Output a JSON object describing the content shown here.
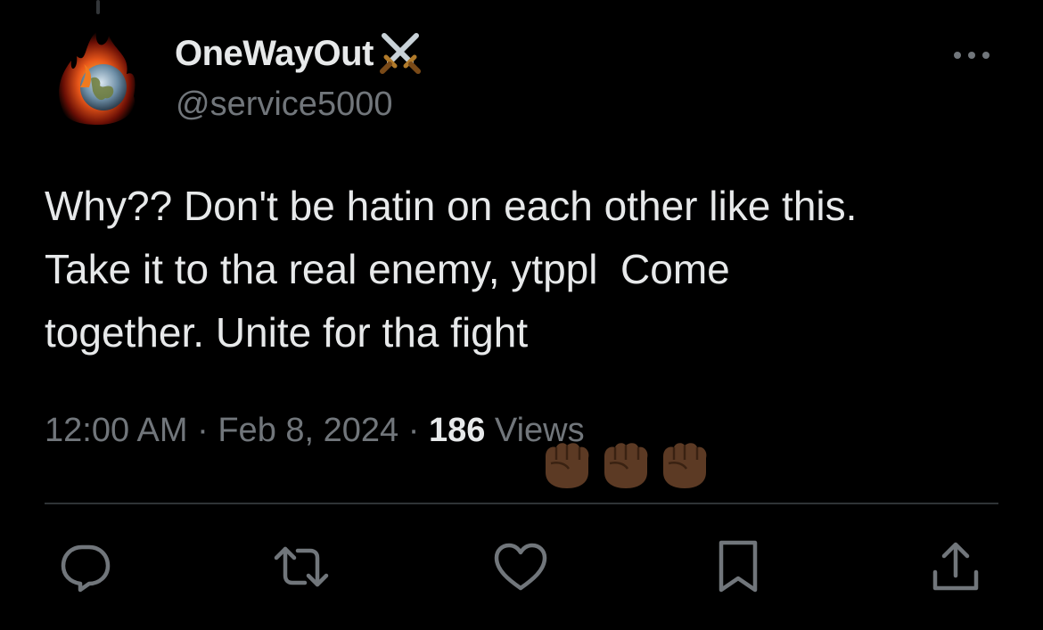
{
  "tweet": {
    "display_name": "OneWayOut",
    "name_emoji": "crossed-swords-icon",
    "handle": "@service5000",
    "text_line1": "Why?? Don't be hatin on each other like this.",
    "text_line2": "Take it to tha real enemy, ytppl  Come",
    "text_line3": "together. Unite for tha fight",
    "text_emoji": "raised-fist-dark-skin-tone-icon",
    "text_emoji_count": 3,
    "time": "12:00 AM",
    "separator": "·",
    "date": "Feb 8, 2024",
    "views_count": "186",
    "views_label": "Views"
  },
  "actions": [
    "reply-icon",
    "retweet-icon",
    "like-icon",
    "bookmark-icon",
    "share-icon"
  ],
  "colors": {
    "background": "#000000",
    "primary_text": "#e7e9ea",
    "secondary_text": "#71767b",
    "divider": "#2f3336",
    "fist_skin": "#5c3a24"
  }
}
